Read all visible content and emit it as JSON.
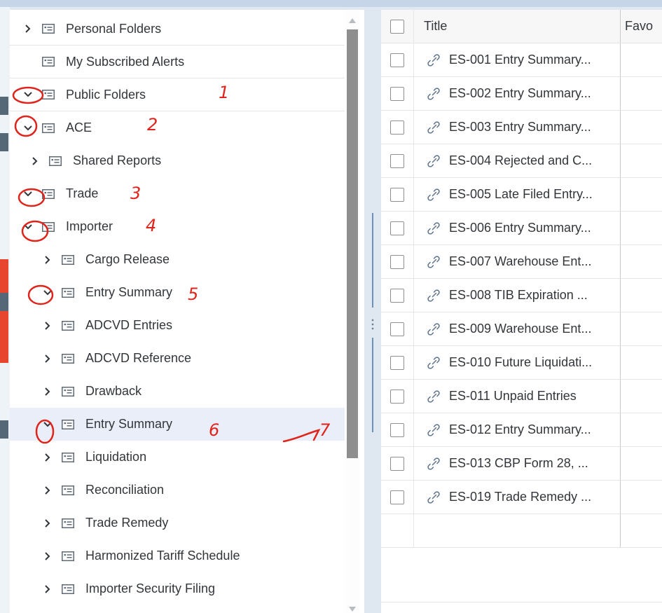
{
  "tree": {
    "items": [
      {
        "label": "Personal Folders",
        "chevron": "right",
        "indent": 0
      },
      {
        "label": "My Subscribed Alerts",
        "chevron": "none",
        "indent": 0
      },
      {
        "label": "Public Folders",
        "chevron": "down",
        "indent": 0
      },
      {
        "label": "ACE",
        "chevron": "down",
        "indent": 0
      },
      {
        "label": "Shared Reports",
        "chevron": "right",
        "indent": 1
      },
      {
        "label": "Trade",
        "chevron": "down",
        "indent": 0
      },
      {
        "label": "Importer",
        "chevron": "down",
        "indent": 0
      },
      {
        "label": "Cargo Release",
        "chevron": "right",
        "indent": 1
      },
      {
        "label": "Entry Summary",
        "chevron": "down",
        "indent": 1
      },
      {
        "label": "ADCVD Entries",
        "chevron": "right",
        "indent": 2
      },
      {
        "label": "ADCVD Reference",
        "chevron": "right",
        "indent": 2
      },
      {
        "label": "Drawback",
        "chevron": "right",
        "indent": 2
      },
      {
        "label": "Entry Summary",
        "chevron": "down",
        "indent": 2,
        "selected": true
      },
      {
        "label": "Liquidation",
        "chevron": "right",
        "indent": 2
      },
      {
        "label": "Reconciliation",
        "chevron": "right",
        "indent": 2
      },
      {
        "label": "Trade Remedy",
        "chevron": "right",
        "indent": 2
      },
      {
        "label": "Harmonized Tariff Schedule",
        "chevron": "right",
        "indent": 1
      },
      {
        "label": "Importer Security Filing",
        "chevron": "right",
        "indent": 1
      }
    ]
  },
  "table": {
    "headers": {
      "title": "Title",
      "favorite": "Favo"
    },
    "rows": [
      "ES-001 Entry Summary...",
      "ES-002 Entry Summary...",
      "ES-003 Entry Summary...",
      "ES-004 Rejected and C...",
      "ES-005 Late Filed Entry...",
      "ES-006 Entry Summary...",
      "ES-007 Warehouse Ent...",
      "ES-008 TIB Expiration ...",
      "ES-009 Warehouse Ent...",
      "ES-010 Future Liquidati...",
      "ES-011 Unpaid Entries",
      "ES-012 Entry Summary...",
      "ES-013 CBP Form 28, ...",
      "ES-019 Trade Remedy ..."
    ]
  },
  "annotations": {
    "step1": "1",
    "step2": "2",
    "step3": "3",
    "step4": "4",
    "step5": "5",
    "step6": "6",
    "step7": "7"
  },
  "colors": {
    "annotation": "#e0231b",
    "selected_row": "#e9eef8",
    "link_icon": "#5b738b",
    "panel_bg": "#dfe7f1"
  }
}
